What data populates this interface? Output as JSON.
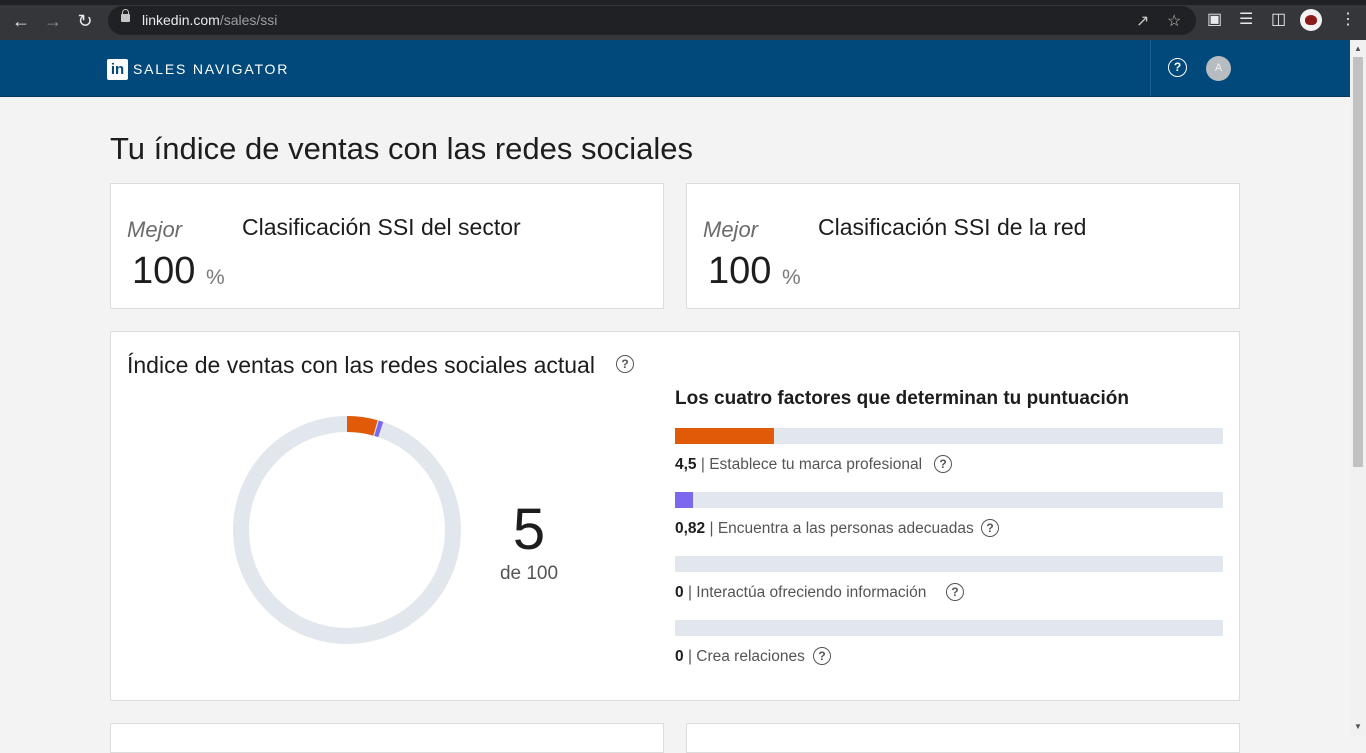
{
  "browser": {
    "url_host": "linkedin.com",
    "url_path": "/sales/ssi"
  },
  "header": {
    "logo_text": "in",
    "brand": "SALES NAVIGATOR",
    "help_glyph": "?",
    "avatar_glyph": "A"
  },
  "page": {
    "title": "Tu índice de ventas con las redes sociales"
  },
  "rank_cards": [
    {
      "label": "Mejor",
      "value": "100",
      "unit": "%",
      "title": "Clasificación SSI del sector"
    },
    {
      "label": "Mejor",
      "value": "100",
      "unit": "%",
      "title": "Clasificación SSI de la red"
    }
  ],
  "ssi": {
    "title": "Índice de ventas con las redes sociales actual",
    "score": "5",
    "score_of": "de 100",
    "factors_title": "Los cuatro factores que determinan tu puntuación",
    "factors": [
      {
        "value": "4,5",
        "label": "Establece tu marca profesional",
        "fraction": 0.18,
        "color": "#e05a07"
      },
      {
        "value": "0,82",
        "label": "Encuentra a las personas adecuadas",
        "fraction": 0.0328,
        "color": "#7b68ee"
      },
      {
        "value": "0",
        "label": "Interactúa ofreciendo información",
        "fraction": 0,
        "color": "#2e8b57"
      },
      {
        "value": "0",
        "label": "Crea relaciones",
        "fraction": 0,
        "color": "#3aa0d8"
      }
    ],
    "track_color": "#e2e7ee",
    "donut_segments": [
      {
        "value": 4.5,
        "color": "#e05a07"
      },
      {
        "value": 0.82,
        "color": "#7b68ee"
      }
    ],
    "donut_max": 100
  },
  "colors": {
    "header_bg": "#00497a",
    "page_bg": "#f3f3f3"
  },
  "icons": [
    "back-arrow-icon",
    "forward-arrow-icon",
    "reload-icon",
    "lock-icon",
    "share-icon",
    "star-icon",
    "puzzle-icon",
    "media-icon",
    "sidepanel-icon",
    "menu-dots-icon",
    "help-icon",
    "question-circle-icon"
  ]
}
